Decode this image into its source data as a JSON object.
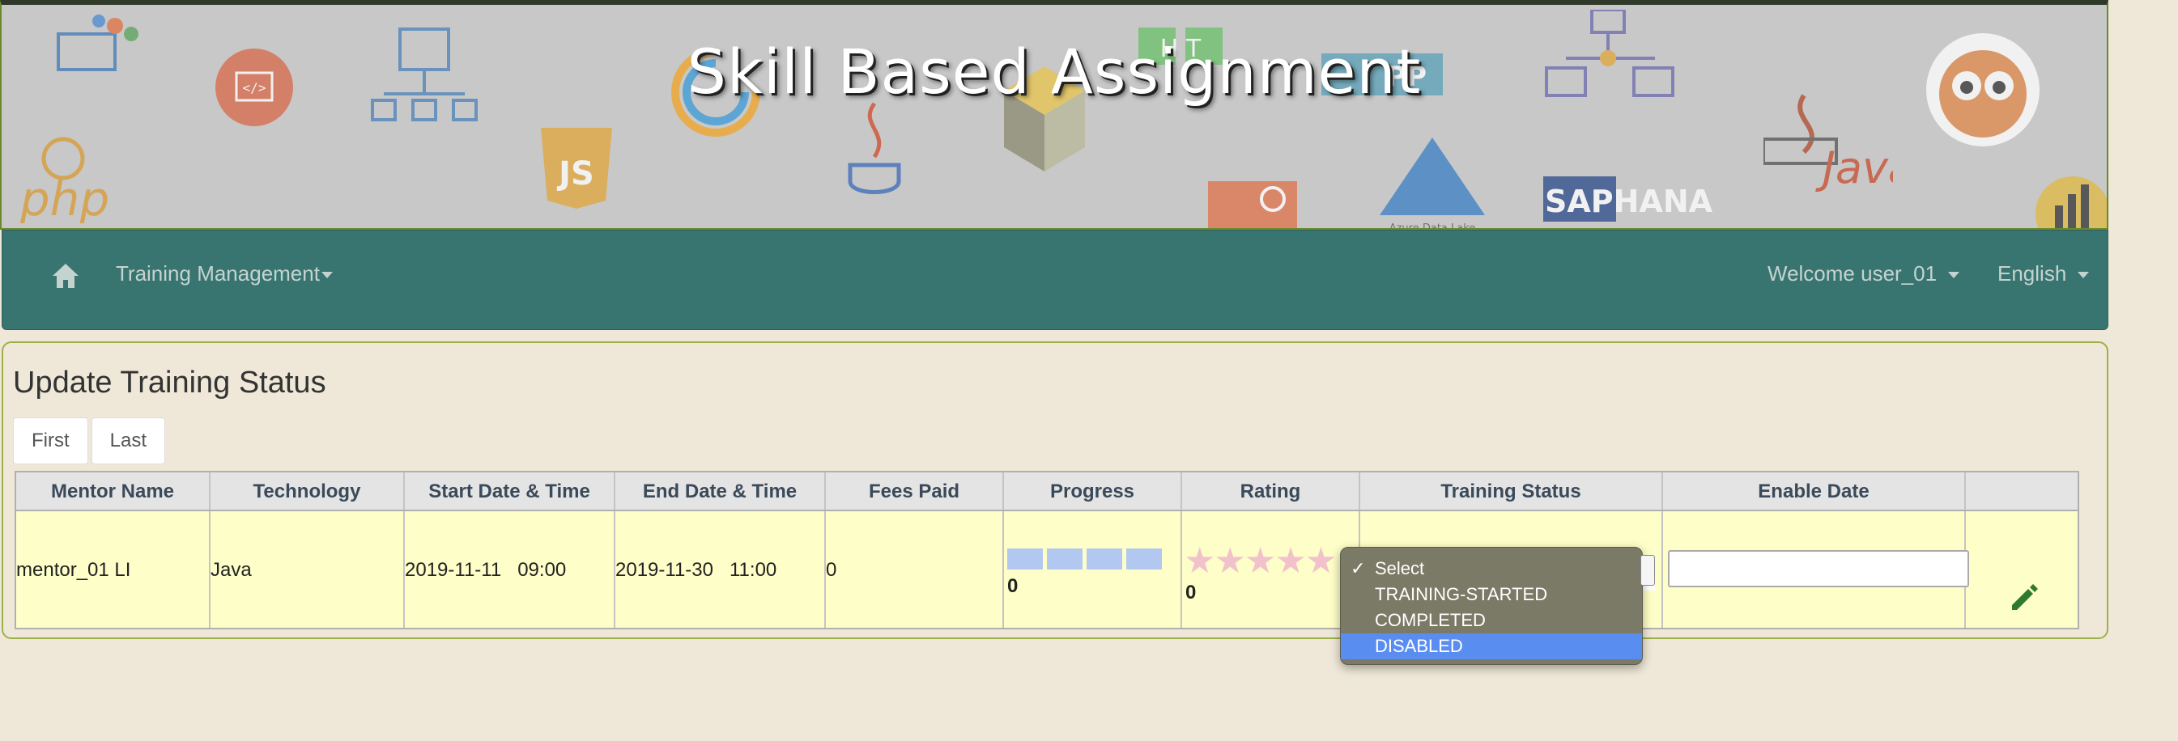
{
  "banner": {
    "title": "Skill Based Assignment",
    "logo_texts": [
      "php",
      "JS",
      "Java",
      "SAPHANA",
      "Azure Data Lake",
      "H T",
      "PP"
    ]
  },
  "navbar": {
    "home_icon": "home-icon",
    "menu_training": "Training Management",
    "user_menu": "Welcome user_01",
    "language_menu": "English",
    "bg_color": "#387571"
  },
  "panel": {
    "title": "Update Training Status",
    "pager": {
      "first": "First",
      "last": "Last"
    }
  },
  "table": {
    "headers": [
      "Mentor Name",
      "Technology",
      "Start Date & Time",
      "End Date & Time",
      "Fees Paid",
      "Progress",
      "Rating",
      "Training Status",
      "Enable Date",
      ""
    ],
    "rows": [
      {
        "mentor": "mentor_01 LI",
        "technology": "Java",
        "start": "2019-11-11   09:00",
        "end": "2019-11-30   11:00",
        "fees": "0",
        "progress_value": "0",
        "progress_fraction": 0,
        "rating_value": "0",
        "rating_stars": "★★★★★",
        "status_selected": "Select",
        "enable_date": "",
        "edit_icon": "pencil-icon"
      }
    ]
  },
  "status_dropdown": {
    "options": [
      "Select",
      "TRAINING-STARTED",
      "COMPLETED",
      "DISABLED"
    ],
    "checked": "Select",
    "highlighted": "DISABLED",
    "check_mark": "✓"
  }
}
